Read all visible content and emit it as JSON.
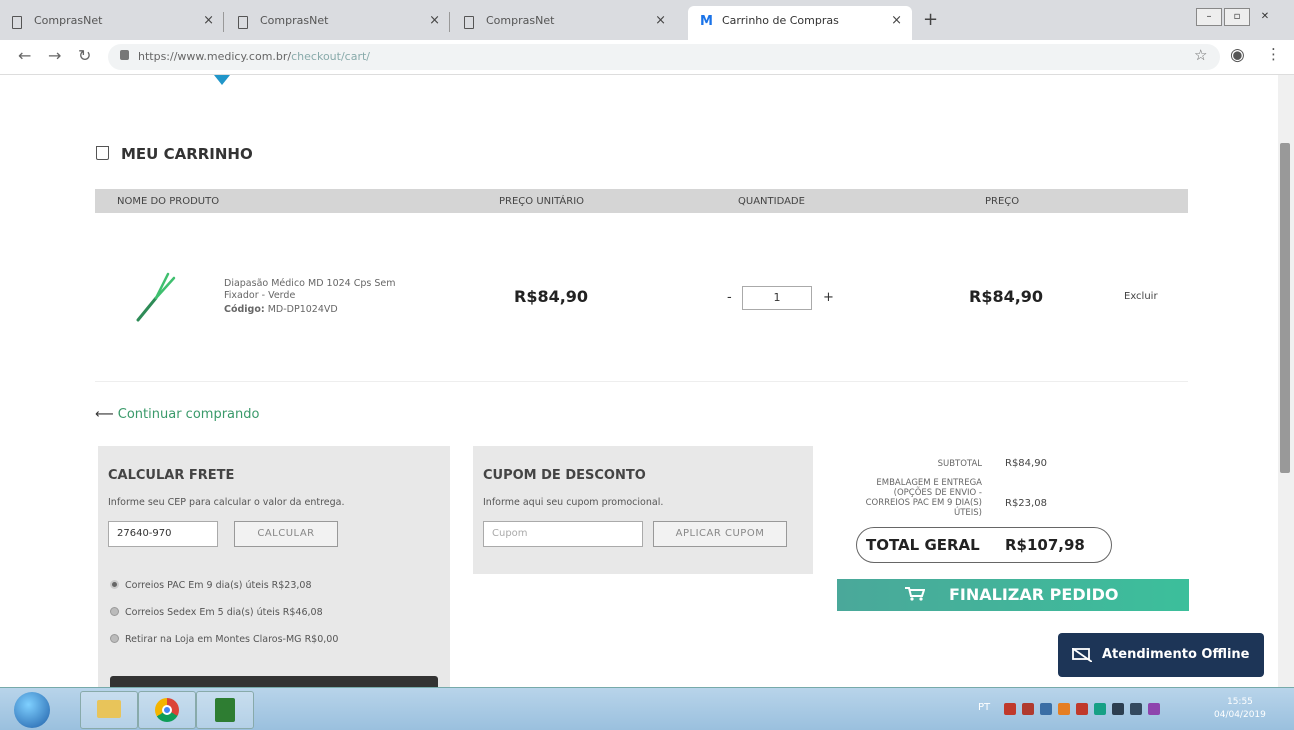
{
  "browser": {
    "tabs": [
      {
        "label": "ComprasNet",
        "active": false
      },
      {
        "label": "ComprasNet",
        "active": false
      },
      {
        "label": "ComprasNet",
        "active": false
      },
      {
        "label": "Carrinho de Compras",
        "active": true
      }
    ],
    "url_host": "https://www.medicy.com.br/",
    "url_path": "checkout/cart/"
  },
  "cart": {
    "title": "MEU CARRINHO",
    "columns": [
      "NOME DO PRODUTO",
      "PREÇO UNITÁRIO",
      "QUANTIDADE",
      "PREÇO"
    ],
    "item": {
      "name": "Diapasão Médico MD 1024 Cps Sem Fixador - Verde",
      "code_label": "Código:",
      "code": "MD-DP1024VD",
      "unit_price": "R$84,90",
      "quantity": "1",
      "minus": "-",
      "plus": "+",
      "price": "R$84,90",
      "remove": "Excluir"
    },
    "continue_label": "Continuar comprando"
  },
  "shipping": {
    "title": "CALCULAR FRETE",
    "description": "Informe seu CEP para calcular o valor da entrega.",
    "cep_value": "27640-970",
    "button": "CALCULAR",
    "options": [
      {
        "label": "Correios PAC Em 9 dia(s) úteis R$23,08",
        "selected": true
      },
      {
        "label": "Correios Sedex Em 5 dia(s) úteis R$46,08",
        "selected": false
      },
      {
        "label": "Retirar na Loja em Montes Claros-MG R$0,00",
        "selected": false
      }
    ]
  },
  "coupon": {
    "title": "CUPOM DE DESCONTO",
    "description": "Informe aqui seu cupom promocional.",
    "placeholder": "Cupom",
    "button": "APLICAR CUPOM"
  },
  "totals": {
    "subtotal_label": "SUBTOTAL",
    "subtotal_value": "R$84,90",
    "shipping_label_1": "EMBALAGEM E ENTREGA",
    "shipping_label_2": "(OPÇÕES DE ENVIO -",
    "shipping_label_3": "CORREIOS PAC EM 9 DIA(S)",
    "shipping_label_4": "ÚTEIS)",
    "shipping_value": "R$23,08",
    "grand_label": "TOTAL GERAL",
    "grand_value": "R$107,98",
    "checkout_button": "FINALIZAR PEDIDO"
  },
  "chat": {
    "label": "Atendimento Offline"
  },
  "taskbar": {
    "lang": "PT",
    "time": "15:55",
    "date": "04/04/2019"
  },
  "colors": {
    "accent": "#3cbf9b",
    "chat": "#1d3557",
    "link": "#3a9a6a"
  }
}
